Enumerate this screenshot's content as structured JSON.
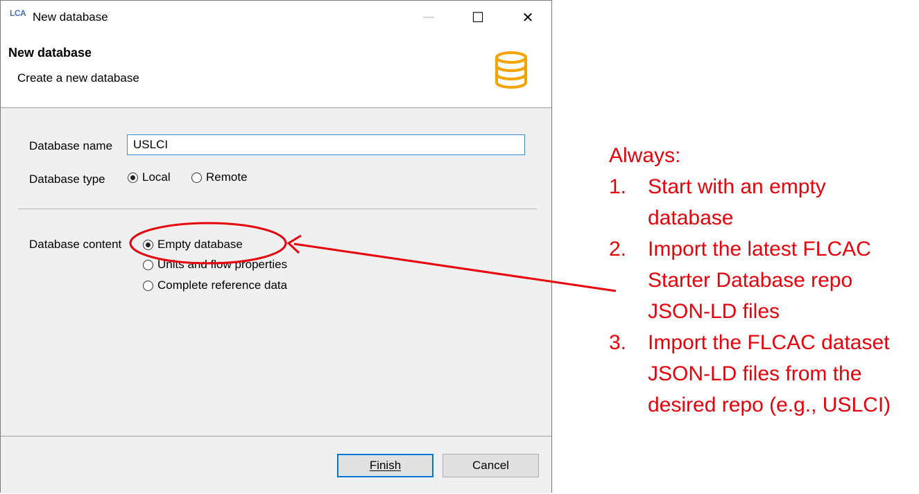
{
  "window": {
    "title": "New database",
    "app_logo": "LCA",
    "controls": {
      "minimize": "—",
      "maximize": "☐",
      "close": "✕"
    }
  },
  "header": {
    "title": "New database",
    "subtitle": "Create a new database",
    "icon": "database-icon",
    "icon_color": "#f5a300"
  },
  "form": {
    "database_name_label": "Database name",
    "database_name_value": "USLCI",
    "database_type_label": "Database type",
    "database_type_options": [
      {
        "label": "Local",
        "selected": true
      },
      {
        "label": "Remote",
        "selected": false
      }
    ],
    "database_content_label": "Database content",
    "database_content_options": [
      {
        "label": "Empty database",
        "selected": true
      },
      {
        "label": "Units and flow properties",
        "selected": false
      },
      {
        "label": "Complete reference data",
        "selected": false
      }
    ]
  },
  "footer": {
    "finish_label": "Finish",
    "cancel_label": "Cancel"
  },
  "annotation": {
    "color": "#e8000b",
    "heading": "Always:",
    "steps": [
      {
        "num": "1.",
        "text": "Start with an empty database"
      },
      {
        "num": "2.",
        "text": "Import the latest FLCAC Starter Database repo JSON-LD files"
      },
      {
        "num": "3.",
        "text": "Import the FLCAC dataset JSON-LD files from the desired repo (e.g., USLCI)"
      }
    ]
  }
}
